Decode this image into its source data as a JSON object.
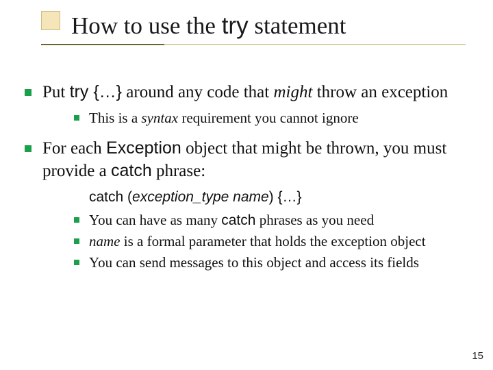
{
  "title": {
    "pre": "How to use the ",
    "code": "try",
    "post": " statement"
  },
  "b1": {
    "pre": "Put ",
    "code": "try {…}",
    "mid": " around any code that ",
    "ital": "might",
    "post": " throw an exception"
  },
  "b1_1": {
    "pre": "This is a ",
    "ital": "syntax",
    "post": " requirement you cannot ignore"
  },
  "b2": {
    "pre": "For each ",
    "code1": "Exception",
    "mid": " object that might be thrown, you must provide a ",
    "code2": "catch",
    "post": " phrase:"
  },
  "b2_syntax": {
    "c1": "catch (",
    "ital": "exception_type  name",
    "c2": ") {…}"
  },
  "b2_1": {
    "pre": "You can have as many ",
    "code": "catch",
    "post": " phrases as you need"
  },
  "b2_2": {
    "ital": "name",
    "post": " is a formal parameter that holds the exception object"
  },
  "b2_3": "You can send messages to this object and access its fields",
  "page_number": "15"
}
